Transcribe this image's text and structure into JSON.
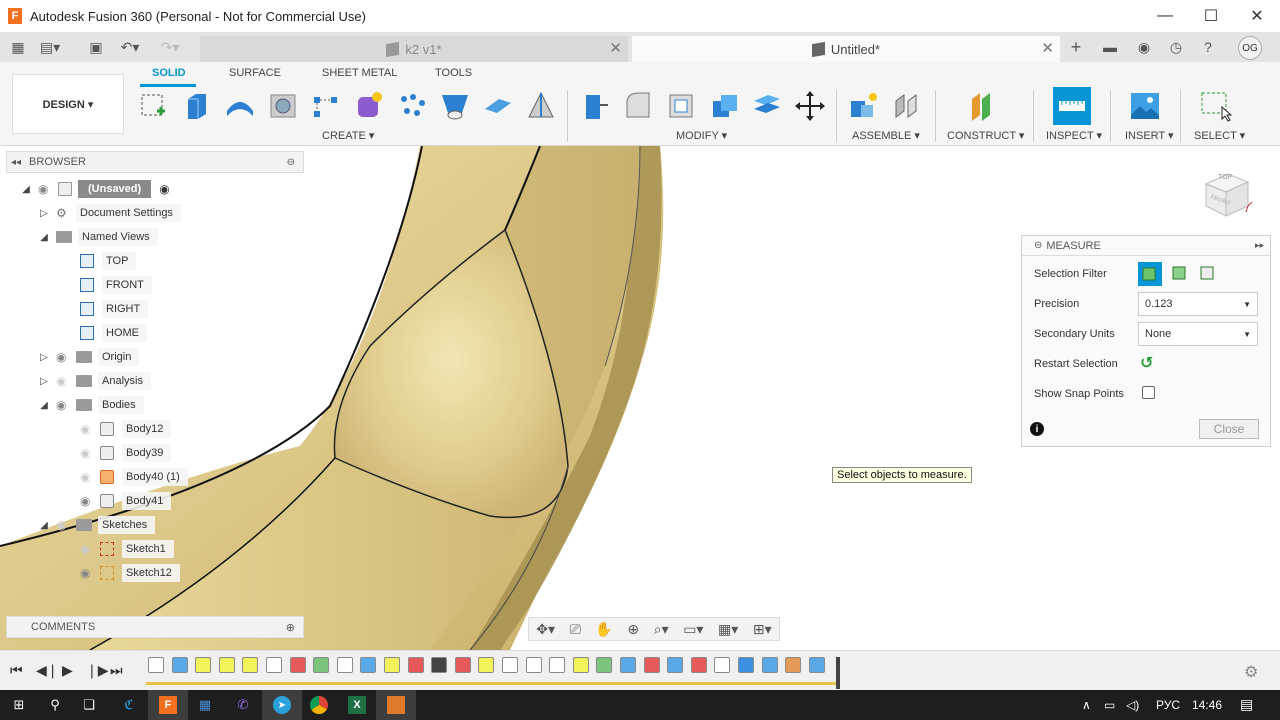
{
  "window": {
    "title": "Autodesk Fusion 360 (Personal - Not for Commercial Use)",
    "logo": "F",
    "minimize": "—",
    "maximize": "☐",
    "close": "✕"
  },
  "tabs": {
    "inactive_label": "k2 v1*",
    "active_label": "Untitled*",
    "close_glyph": "✕",
    "avatar": "OG"
  },
  "ribbon": {
    "workspace": "DESIGN ▾",
    "tabs": [
      "SOLID",
      "SURFACE",
      "SHEET METAL",
      "TOOLS"
    ],
    "groups": {
      "create": "CREATE ▾",
      "modify": "MODIFY ▾",
      "assemble": "ASSEMBLE ▾",
      "construct": "CONSTRUCT ▾",
      "inspect": "INSPECT ▾",
      "insert": "INSERT ▾",
      "select": "SELECT ▾"
    }
  },
  "browser": {
    "title": "BROWSER",
    "root": "(Unsaved)",
    "items": {
      "document_settings": "Document Settings",
      "named_views": "Named Views",
      "view_top": "TOP",
      "view_front": "FRONT",
      "view_right": "RIGHT",
      "view_home": "HOME",
      "origin": "Origin",
      "analysis": "Analysis",
      "bodies": "Bodies",
      "body12": "Body12",
      "body39": "Body39",
      "body40": "Body40 (1)",
      "body41": "Body41",
      "sketches": "Sketches",
      "sketch1": "Sketch1",
      "sketch12": "Sketch12"
    },
    "comments": "COMMENTS"
  },
  "viewcube": {
    "top": "TOP",
    "front": "FRONT"
  },
  "measure": {
    "title": "MEASURE",
    "selection_filter_label": "Selection Filter",
    "precision_label": "Precision",
    "precision_value": "0.123",
    "secondary_units_label": "Secondary Units",
    "secondary_units_value": "None",
    "restart_label": "Restart Selection",
    "snap_label": "Show Snap Points",
    "close_label": "Close"
  },
  "tooltip": "Select objects to measure.",
  "taskbar": {
    "language": "РУС",
    "time": "14:46"
  },
  "colors": {
    "accent": "#0696d7",
    "model_gold": "#e2d08f",
    "taskbar": "#1e1e1e"
  }
}
